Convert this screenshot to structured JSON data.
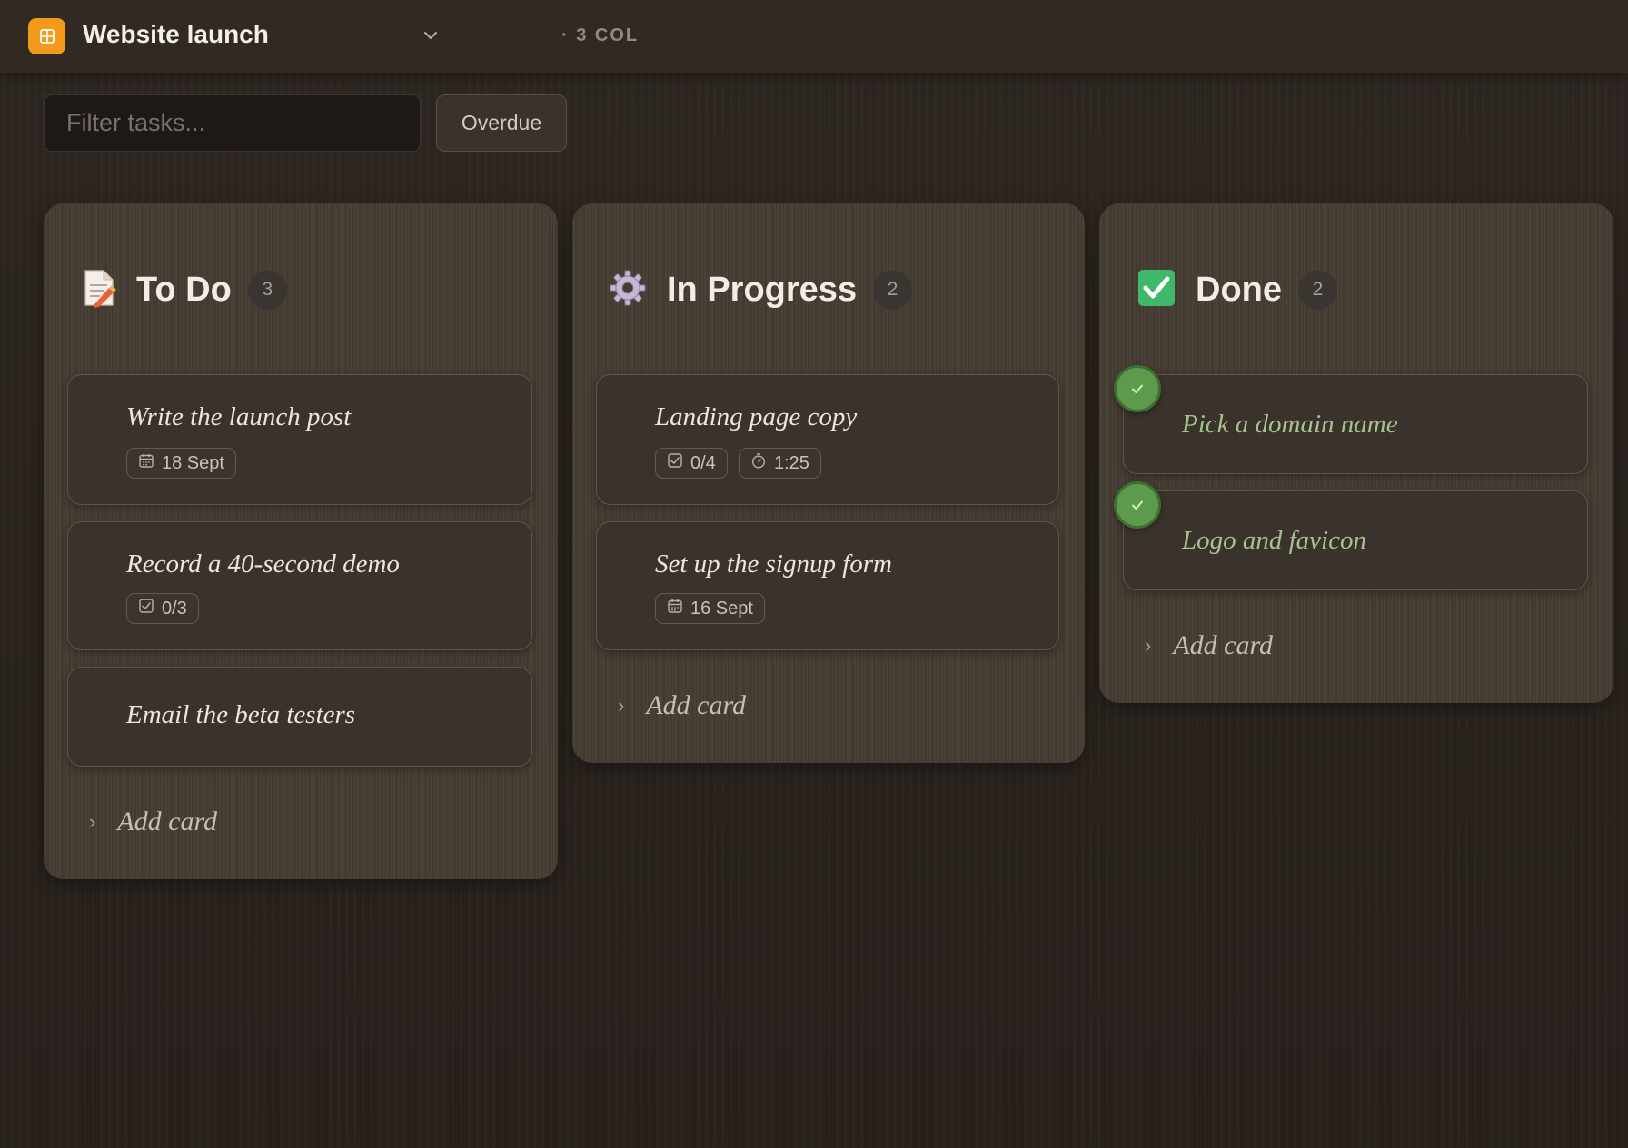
{
  "header": {
    "board_title": "Website launch",
    "column_count": "· 3 COL",
    "app_icon": "board-icon",
    "dropdown_icon": "chevron-down-icon"
  },
  "toolbar": {
    "filter_placeholder": "Filter tasks...",
    "overdue_label": "Overdue"
  },
  "colors": {
    "accent": "#f39a1b",
    "done_green": "#5e9a4c"
  },
  "columns": [
    {
      "title": "To Do",
      "count": "3",
      "icon": "memo-icon",
      "add_label": "Add card",
      "cards": [
        {
          "title": "Write the launch post",
          "chips": [
            {
              "icon": "calendar-icon",
              "text": "18 Sept"
            }
          ]
        },
        {
          "title": "Record a 40-second demo",
          "chips": [
            {
              "icon": "checklist-icon",
              "text": "0/3"
            }
          ]
        },
        {
          "title": "Email the beta testers",
          "chips": []
        }
      ]
    },
    {
      "title": "In Progress",
      "count": "2",
      "icon": "gear-icon",
      "add_label": "Add card",
      "cards": [
        {
          "title": "Landing page copy",
          "chips": [
            {
              "icon": "checklist-icon",
              "text": "0/4"
            },
            {
              "icon": "stopwatch-icon",
              "text": "1:25"
            }
          ]
        },
        {
          "title": "Set up the signup form",
          "chips": [
            {
              "icon": "calendar-icon",
              "text": "16 Sept"
            }
          ]
        }
      ]
    },
    {
      "title": "Done",
      "count": "2",
      "icon": "check-box-icon",
      "add_label": "Add card",
      "cards": [
        {
          "title": "Pick a domain name",
          "done": true
        },
        {
          "title": "Logo and favicon",
          "done": true
        }
      ]
    }
  ]
}
